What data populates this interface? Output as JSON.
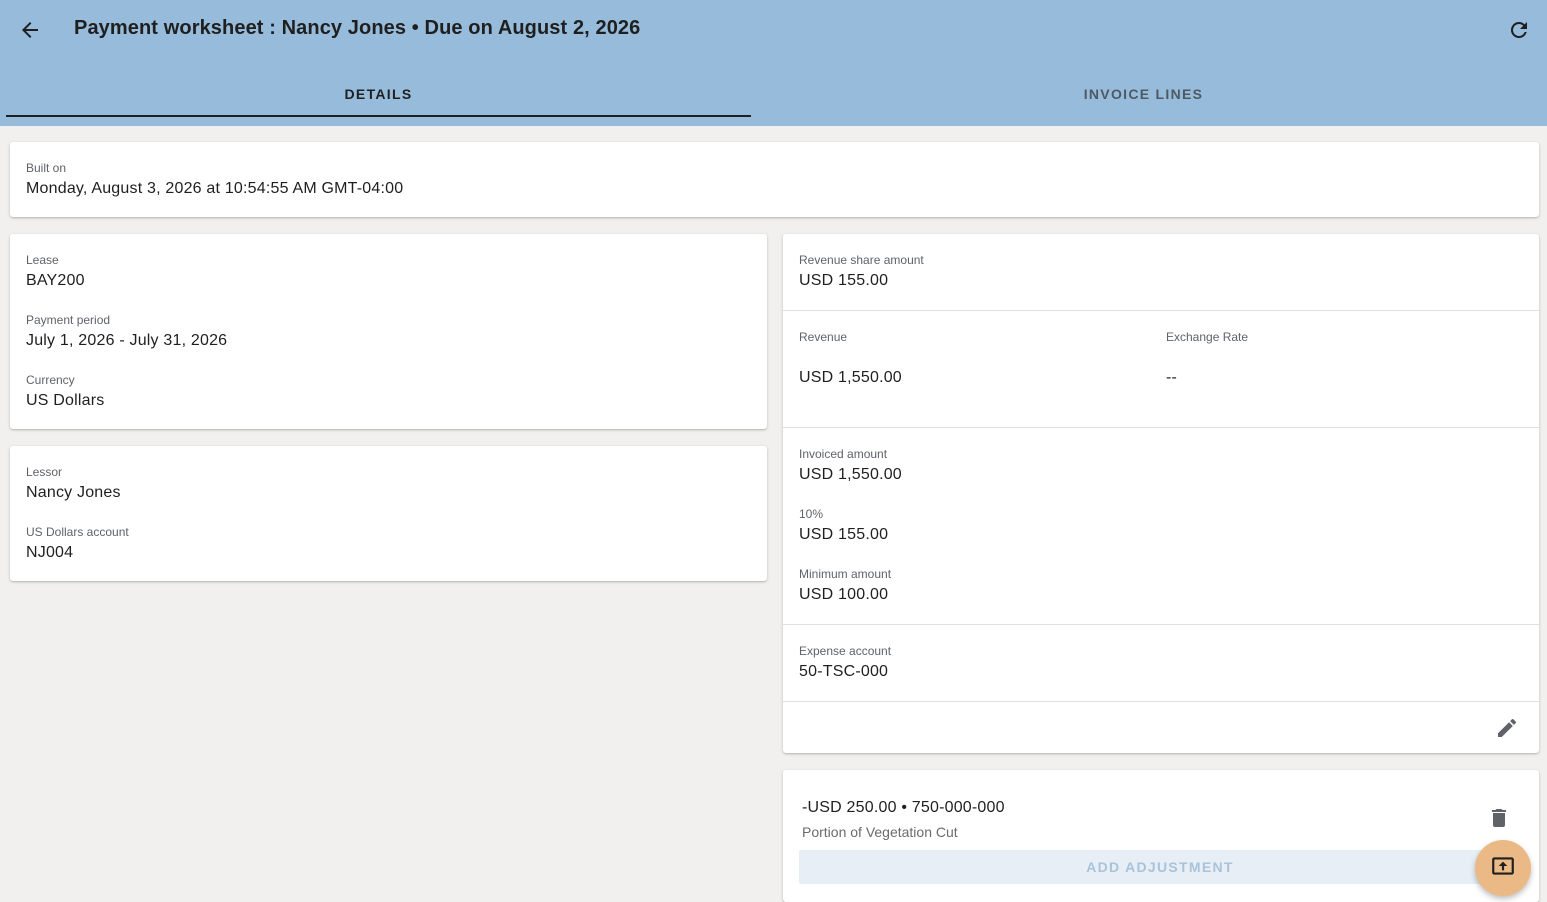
{
  "header": {
    "title": "Payment worksheet : Nancy Jones • Due on August 2, 2026",
    "back_icon": "arrow-left-icon",
    "refresh_icon": "refresh-icon"
  },
  "tabs": [
    {
      "label": "DETAILS",
      "active": true
    },
    {
      "label": "INVOICE LINES",
      "active": false
    }
  ],
  "built": {
    "label": "Built on",
    "value": "Monday, August 3, 2026 at 10:54:55 AM GMT-04:00"
  },
  "lease_card": {
    "lease_label": "Lease",
    "lease_value": "BAY200",
    "period_label": "Payment period",
    "period_value": "July 1, 2026 - July 31, 2026",
    "currency_label": "Currency",
    "currency_value": "US Dollars"
  },
  "lessor_card": {
    "lessor_label": "Lessor",
    "lessor_value": "Nancy Jones",
    "account_label": "US Dollars account",
    "account_value": "NJ004"
  },
  "revenue_card": {
    "share_label": "Revenue share amount",
    "share_value": "USD 155.00",
    "revenue_label": "Revenue",
    "revenue_value": "USD 1,550.00",
    "rate_label": "Exchange Rate",
    "rate_value": "--",
    "invoiced_label": "Invoiced amount",
    "invoiced_value": "USD 1,550.00",
    "pct_label": "10%",
    "pct_value": "USD 155.00",
    "min_label": "Minimum amount",
    "min_value": "USD 100.00",
    "expense_label": "Expense account",
    "expense_value": "50-TSC-000"
  },
  "adjustment": {
    "line": "-USD 250.00 • 750-000-000",
    "description": "Portion of Vegetation Cut",
    "add_label": "ADD ADJUSTMENT"
  },
  "colors": {
    "appbar": "#97bcdb",
    "fab": "#ebb986",
    "background": "#f1f0ef"
  }
}
